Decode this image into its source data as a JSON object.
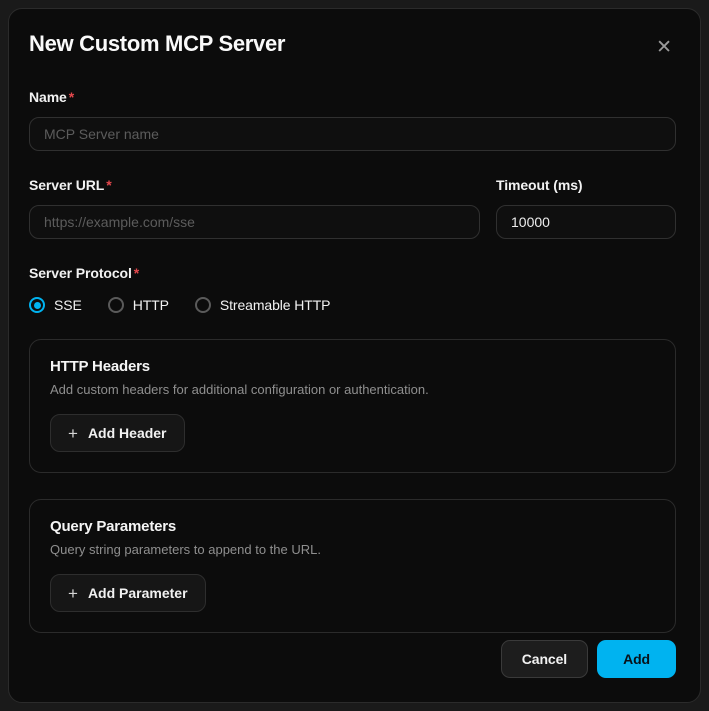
{
  "theme": {
    "accent": "#00b3f0",
    "required": "#e5484d"
  },
  "icons": {
    "close": "✕",
    "plus": "+"
  },
  "modal": {
    "title": "New Custom MCP Server"
  },
  "fields": {
    "name": {
      "label": "Name",
      "required": "*",
      "placeholder": "MCP Server name",
      "value": ""
    },
    "server_url": {
      "label": "Server URL",
      "required": "*",
      "placeholder": "https://example.com/sse",
      "value": ""
    },
    "timeout": {
      "label": "Timeout (ms)",
      "value": "10000"
    },
    "protocol": {
      "label": "Server Protocol",
      "required": "*",
      "options": [
        {
          "label": "SSE",
          "selected": true
        },
        {
          "label": "HTTP",
          "selected": false
        },
        {
          "label": "Streamable HTTP",
          "selected": false
        }
      ]
    }
  },
  "sections": {
    "headers": {
      "title": "HTTP Headers",
      "description": "Add custom headers for additional configuration or authentication.",
      "button_label": "Add Header"
    },
    "query_params": {
      "title": "Query Parameters",
      "description": "Query string parameters to append to the URL.",
      "button_label": "Add Parameter"
    }
  },
  "footer": {
    "cancel_label": "Cancel",
    "add_label": "Add"
  }
}
